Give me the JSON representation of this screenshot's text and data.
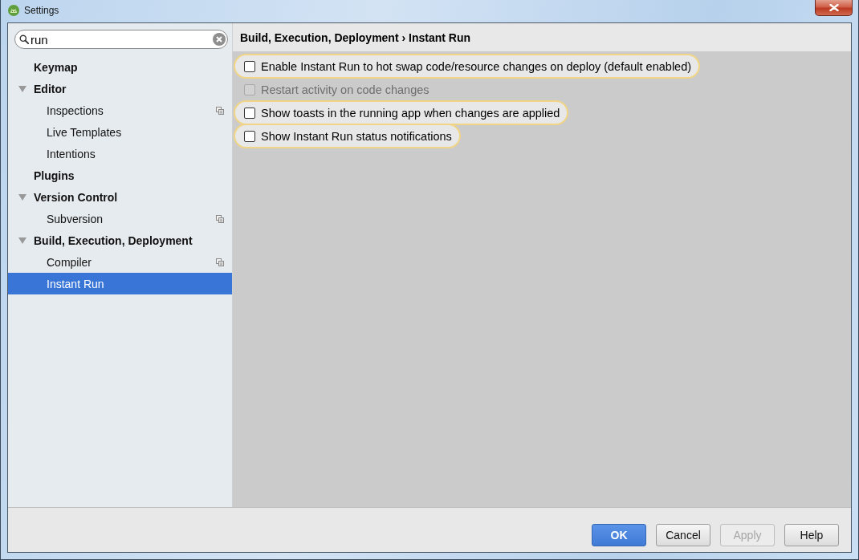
{
  "window": {
    "title": "Settings"
  },
  "search": {
    "value": "run"
  },
  "tree": {
    "items": [
      {
        "label": "Keymap",
        "selected": false,
        "project_level": false
      },
      {
        "label": "Editor",
        "selected": false,
        "project_level": false,
        "expanded": true,
        "children": [
          {
            "label": "Inspections",
            "selected": false,
            "project_level": true
          },
          {
            "label": "Live Templates",
            "selected": false,
            "project_level": false
          },
          {
            "label": "Intentions",
            "selected": false,
            "project_level": false
          }
        ]
      },
      {
        "label": "Plugins",
        "selected": false,
        "project_level": false
      },
      {
        "label": "Version Control",
        "selected": false,
        "project_level": false,
        "expanded": true,
        "children": [
          {
            "label": "Subversion",
            "selected": false,
            "project_level": true
          }
        ]
      },
      {
        "label": "Build, Execution, Deployment",
        "selected": false,
        "project_level": false,
        "expanded": true,
        "children": [
          {
            "label": "Compiler",
            "selected": false,
            "project_level": true
          },
          {
            "label": "Instant Run",
            "selected": true,
            "project_level": false
          }
        ]
      }
    ]
  },
  "breadcrumb": "Build, Execution, Deployment › Instant Run",
  "options": [
    {
      "label": "Enable Instant Run to hot swap code/resource changes on deploy (default enabled)",
      "checked": false,
      "disabled": false,
      "highlighted": true
    },
    {
      "label": "Restart activity on code changes",
      "checked": false,
      "disabled": true,
      "highlighted": false
    },
    {
      "label": "Show toasts in the running app when changes are applied",
      "checked": false,
      "disabled": false,
      "highlighted": true
    },
    {
      "label": "Show Instant Run status notifications",
      "checked": false,
      "disabled": false,
      "highlighted": true
    }
  ],
  "buttons": [
    {
      "label": "OK",
      "default": true,
      "disabled": false
    },
    {
      "label": "Cancel",
      "default": false,
      "disabled": false
    },
    {
      "label": "Apply",
      "default": false,
      "disabled": true
    },
    {
      "label": "Help",
      "default": false,
      "disabled": false
    }
  ]
}
